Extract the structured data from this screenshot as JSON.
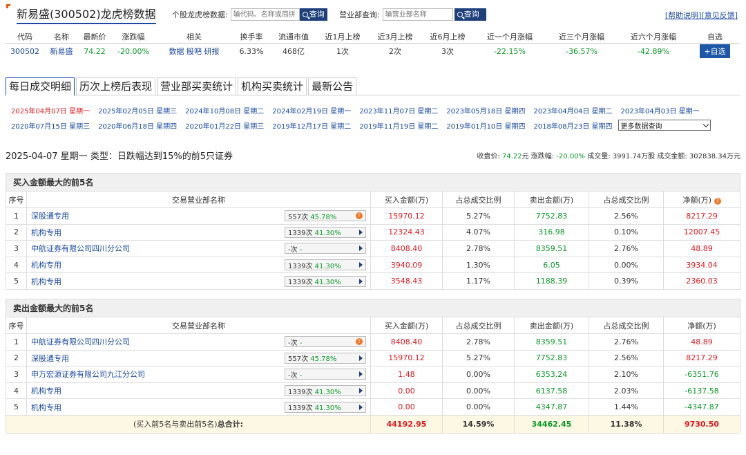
{
  "header": {
    "title": "新易盛(300502)龙虎榜数据",
    "stock_search_label": "个股龙虎榜数据:",
    "stock_search_placeholder": "输代码、名称或简拼",
    "dept_search_label": "营业部查询:",
    "dept_search_placeholder": "输营业部名称",
    "search_button": "查询",
    "help_link": "[帮助说明]",
    "feedback_link": "[意见反馈]"
  },
  "quote": {
    "headers": [
      "代码",
      "名称",
      "最新价",
      "涨跌幅",
      "相关",
      "换手率",
      "流通市值",
      "近1月上榜",
      "近3月上榜",
      "近6月上榜",
      "近一个月涨幅",
      "近三个月涨幅",
      "近六个月涨幅",
      "自选"
    ],
    "code": "300502",
    "name": "新易盛",
    "price": "74.22",
    "change": "-20.00%",
    "related": [
      "数据",
      "股吧",
      "研报"
    ],
    "turnover": "6.33%",
    "mktcap": "468亿",
    "m1": "1次",
    "m3": "2次",
    "m6": "3次",
    "r1": "-22.15%",
    "r3": "-36.57%",
    "r6": "-42.89%",
    "add": "+自选"
  },
  "tabs": [
    "每日成交明细",
    "历次上榜后表现",
    "营业部买卖统计",
    "机构买卖统计",
    "最新公告"
  ],
  "dates_row1": [
    "2025年04月07日 星期一",
    "2025年02月05日 星期三",
    "2024年10月08日 星期二",
    "2024年02月19日 星期一",
    "2023年11月07日 星期二",
    "2023年05月18日 星期四",
    "2023年04月04日 星期二",
    "2023年04月03日 星期一"
  ],
  "dates_row2": [
    "2020年07月15日 星期三",
    "2020年06月18日 星期四",
    "2020年01月22日 星期三",
    "2019年12月17日 星期二",
    "2019年11月19日 星期二",
    "2019年01月10日 星期四",
    "2018年08月23日 星期四"
  ],
  "more_dates": "更多数据查询",
  "summary": {
    "title": "2025-04-07 星期一 类型：日跌幅达到15%的前5只证券",
    "close_label": "收盘价: ",
    "close": "74.22",
    "close_unit": "元",
    "chg_label": "涨跌幅: ",
    "chg": "-20.00%",
    "vol_label": "成交量: ",
    "vol": "3991.74万股",
    "amt_label": "成交金额: ",
    "amt": "302838.34万元"
  },
  "table_headers": [
    "序号",
    "交易营业部名称",
    "买入金额(万)",
    "占总成交比例",
    "卖出金额(万)",
    "占总成交比例",
    "净额(万)"
  ],
  "buy": {
    "caption": "买入金额最大的前5名",
    "rows": [
      {
        "no": "1",
        "name": "深股通专用",
        "count": "557次",
        "pct": "45.78%",
        "icon": "dot",
        "buy": "15970.12",
        "buy_ratio": "5.27%",
        "sell": "7752.83",
        "sell_ratio": "2.56%",
        "net": "8217.29",
        "net_sign": "pos"
      },
      {
        "no": "2",
        "name": "机构专用",
        "count": "1339次",
        "pct": "41.30%",
        "icon": "arrow",
        "buy": "12324.43",
        "buy_ratio": "4.07%",
        "sell": "316.98",
        "sell_ratio": "0.10%",
        "net": "12007.45",
        "net_sign": "pos"
      },
      {
        "no": "3",
        "name": "中航证券有限公司四川分公司",
        "count": "-次",
        "pct": "-",
        "icon": "arrow",
        "buy": "8408.40",
        "buy_ratio": "2.78%",
        "sell": "8359.51",
        "sell_ratio": "2.76%",
        "net": "48.89",
        "net_sign": "pos"
      },
      {
        "no": "4",
        "name": "机构专用",
        "count": "1339次",
        "pct": "41.30%",
        "icon": "arrow",
        "buy": "3940.09",
        "buy_ratio": "1.30%",
        "sell": "6.05",
        "sell_ratio": "0.00%",
        "net": "3934.04",
        "net_sign": "pos"
      },
      {
        "no": "5",
        "name": "机构专用",
        "count": "1339次",
        "pct": "41.30%",
        "icon": "arrow",
        "buy": "3548.43",
        "buy_ratio": "1.17%",
        "sell": "1188.39",
        "sell_ratio": "0.39%",
        "net": "2360.03",
        "net_sign": "pos"
      }
    ]
  },
  "sell": {
    "caption": "卖出金额最大的前5名",
    "rows": [
      {
        "no": "1",
        "name": "中航证券有限公司四川分公司",
        "count": "-次",
        "pct": "-",
        "icon": "dot",
        "buy": "8408.40",
        "buy_ratio": "2.78%",
        "sell": "8359.51",
        "sell_ratio": "2.76%",
        "net": "48.89",
        "net_sign": "pos"
      },
      {
        "no": "2",
        "name": "深股通专用",
        "count": "557次",
        "pct": "45.78%",
        "icon": "arrow",
        "buy": "15970.12",
        "buy_ratio": "5.27%",
        "sell": "7752.83",
        "sell_ratio": "2.56%",
        "net": "8217.29",
        "net_sign": "pos"
      },
      {
        "no": "3",
        "name": "申万宏源证券有限公司九江分公司",
        "count": "-次",
        "pct": "-",
        "icon": "arrow",
        "buy": "1.48",
        "buy_ratio": "0.00%",
        "sell": "6353.24",
        "sell_ratio": "2.10%",
        "net": "-6351.76",
        "net_sign": "neg"
      },
      {
        "no": "4",
        "name": "机构专用",
        "count": "1339次",
        "pct": "41.30%",
        "icon": "arrow",
        "buy": "0.00",
        "buy_ratio": "0.00%",
        "sell": "6137.58",
        "sell_ratio": "2.03%",
        "net": "-6137.58",
        "net_sign": "neg"
      },
      {
        "no": "5",
        "name": "机构专用",
        "count": "1339次",
        "pct": "41.30%",
        "icon": "arrow",
        "buy": "0.00",
        "buy_ratio": "0.00%",
        "sell": "4347.87",
        "sell_ratio": "1.44%",
        "net": "-4347.87",
        "net_sign": "neg"
      }
    ],
    "total_label_pre": "(买入前5名与卖出前5名)",
    "total_label": "总合计:",
    "total_buy": "44192.95",
    "total_buy_ratio": "14.59%",
    "total_sell": "34462.45",
    "total_sell_ratio": "11.38%",
    "total_net": "9730.50"
  },
  "colors": {
    "accent": "#1a48a0",
    "up": "#e0191f",
    "down": "#0a9a27"
  }
}
